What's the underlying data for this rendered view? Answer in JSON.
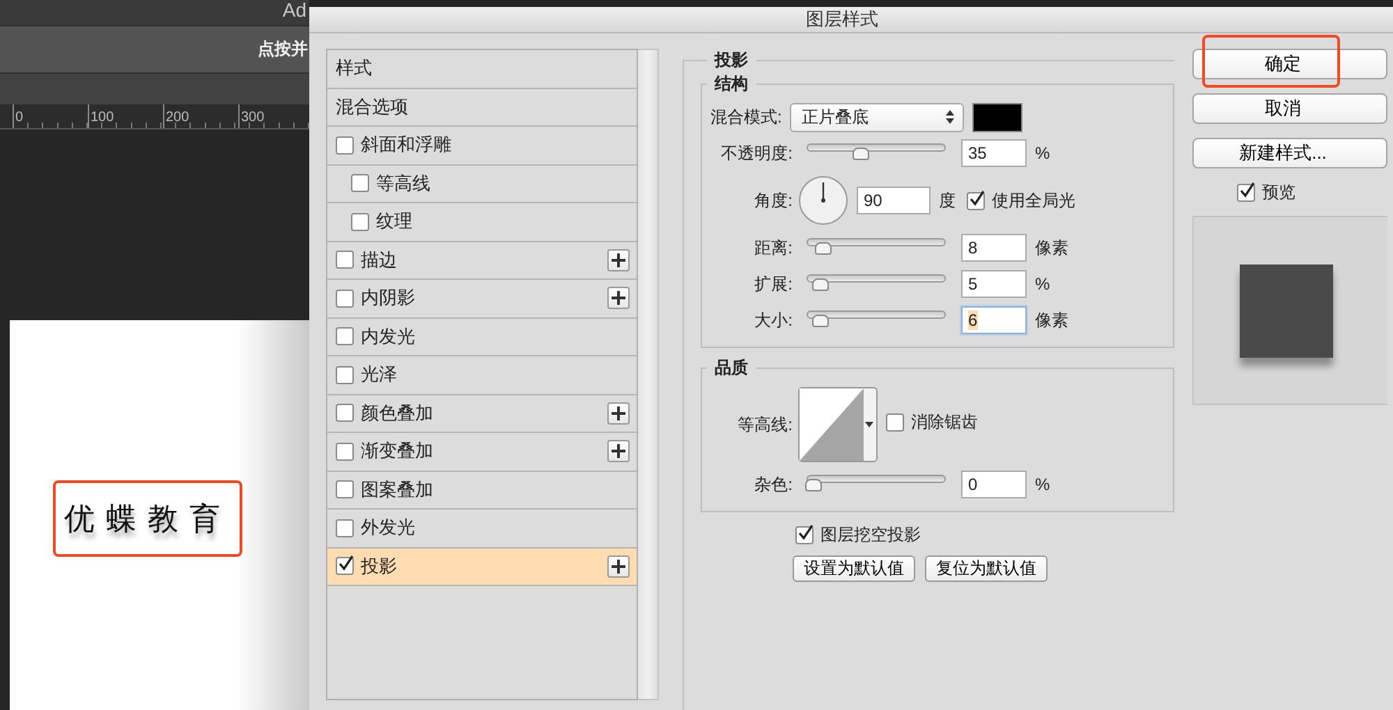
{
  "app": {
    "title": "Ad",
    "options_text": "点按并",
    "ruler_ticks": [
      "0",
      "100",
      "200",
      "300"
    ],
    "canvas_text": "优蝶教育",
    "canvas_highlighted": true
  },
  "dialog": {
    "title": "图层样式",
    "styles": [
      {
        "label": "样式",
        "kind": "plain",
        "selected": false,
        "add": false
      },
      {
        "label": "混合选项",
        "kind": "plain",
        "selected": false,
        "add": false
      },
      {
        "label": "斜面和浮雕",
        "kind": "check",
        "checked": false,
        "selected": false,
        "add": false
      },
      {
        "label": "等高线",
        "kind": "subcheck",
        "checked": false,
        "selected": false,
        "add": false
      },
      {
        "label": "纹理",
        "kind": "subcheck",
        "checked": false,
        "selected": false,
        "add": false
      },
      {
        "label": "描边",
        "kind": "check",
        "checked": false,
        "selected": false,
        "add": true
      },
      {
        "label": "内阴影",
        "kind": "check",
        "checked": false,
        "selected": false,
        "add": true
      },
      {
        "label": "内发光",
        "kind": "check",
        "checked": false,
        "selected": false,
        "add": false
      },
      {
        "label": "光泽",
        "kind": "check",
        "checked": false,
        "selected": false,
        "add": false
      },
      {
        "label": "颜色叠加",
        "kind": "check",
        "checked": false,
        "selected": false,
        "add": true
      },
      {
        "label": "渐变叠加",
        "kind": "check",
        "checked": false,
        "selected": false,
        "add": true
      },
      {
        "label": "图案叠加",
        "kind": "check",
        "checked": false,
        "selected": false,
        "add": false
      },
      {
        "label": "外发光",
        "kind": "check",
        "checked": false,
        "selected": false,
        "add": false
      },
      {
        "label": "投影",
        "kind": "check",
        "checked": true,
        "selected": true,
        "add": true
      }
    ],
    "panel": {
      "title": "投影",
      "structure": {
        "title": "结构",
        "blend_label": "混合模式:",
        "blend_mode": "正片叠底",
        "color": "#000000",
        "rows": [
          {
            "kind": "slider",
            "label": "不透明度:",
            "level": 0.35,
            "value": "35",
            "unit": "%",
            "focused": false
          },
          {
            "kind": "angle",
            "label": "角度:",
            "value": "90",
            "unit": "度",
            "global_light": {
              "label": "使用全局光",
              "checked": true
            }
          },
          {
            "kind": "slider",
            "label": "距离:",
            "level": 0.07,
            "value": "8",
            "unit": "像素",
            "focused": false
          },
          {
            "kind": "slider",
            "label": "扩展:",
            "level": 0.05,
            "value": "5",
            "unit": "%",
            "focused": false
          },
          {
            "kind": "slider",
            "label": "大小:",
            "level": 0.05,
            "value": "6",
            "unit": "像素",
            "focused": true
          }
        ]
      },
      "quality": {
        "title": "品质",
        "contour_label": "等高线:",
        "antialias": {
          "label": "消除锯齿",
          "checked": false
        },
        "noise": {
          "label": "杂色:",
          "level": 0,
          "value": "0",
          "unit": "%",
          "focused": false
        }
      },
      "knockout": {
        "label": "图层挖空投影",
        "checked": true
      },
      "buttons": [
        "设置为默认值",
        "复位为默认值"
      ]
    },
    "actions": [
      {
        "label": "确定",
        "highlighted": true
      },
      {
        "label": "取消",
        "highlighted": false
      },
      {
        "label": "新建样式...",
        "highlighted": false
      }
    ],
    "preview": {
      "label": "预览",
      "checked": true
    }
  }
}
